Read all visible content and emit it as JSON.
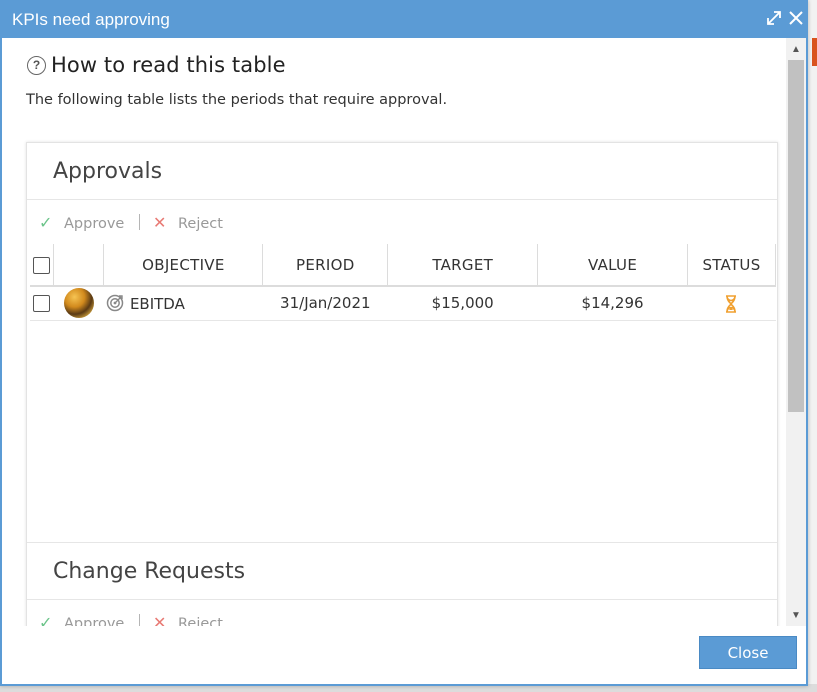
{
  "dialog": {
    "title": "KPIs need approving",
    "expand_icon": "expand-icon",
    "close_icon": "close-icon"
  },
  "help": {
    "icon": "question-circle-icon",
    "title": "How to read this table",
    "text": "The following table lists the periods that require approval."
  },
  "approvals": {
    "title": "Approvals",
    "approve_label": "Approve",
    "reject_label": "Reject",
    "columns": [
      "OBJECTIVE",
      "PERIOD",
      "TARGET",
      "VALUE",
      "STATUS"
    ],
    "rows": [
      {
        "objective": "EBITDA",
        "period": "31/Jan/2021",
        "target": "$15,000",
        "value": "$14,296",
        "status_icon": "hourglass-icon",
        "status_color": "#f0a030"
      }
    ]
  },
  "change_requests": {
    "title": "Change Requests",
    "approve_label": "Approve",
    "reject_label": "Reject"
  },
  "footer": {
    "close_label": "Close"
  },
  "colors": {
    "accent": "#5b9bd5",
    "approve": "#6cc48a",
    "reject": "#e87a74"
  }
}
